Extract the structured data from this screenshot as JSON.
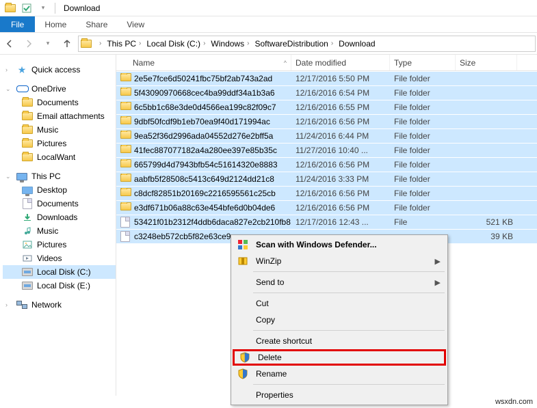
{
  "window": {
    "title": "Download"
  },
  "ribbon": {
    "file": "File",
    "tabs": [
      "Home",
      "Share",
      "View"
    ]
  },
  "breadcrumb": [
    "This PC",
    "Local Disk (C:)",
    "Windows",
    "SoftwareDistribution",
    "Download"
  ],
  "sidebar": {
    "quick": {
      "label": "Quick access"
    },
    "onedrive": {
      "label": "OneDrive",
      "children": [
        "Documents",
        "Email attachments",
        "Music",
        "Pictures",
        "LocalWant"
      ]
    },
    "thispc": {
      "label": "This PC",
      "children": [
        "Desktop",
        "Documents",
        "Downloads",
        "Music",
        "Pictures",
        "Videos",
        "Local Disk (C:)",
        "Local Disk (E:)"
      ]
    },
    "network": {
      "label": "Network"
    }
  },
  "columns": {
    "name": "Name",
    "date": "Date modified",
    "type": "Type",
    "size": "Size"
  },
  "rows": [
    {
      "icon": "folder",
      "name": "2e5e7fce6d50241fbc75bf2ab743a2ad",
      "date": "12/17/2016 5:50 PM",
      "type": "File folder",
      "size": ""
    },
    {
      "icon": "folder",
      "name": "5f43090970668cec4ba99ddf34a1b3a6",
      "date": "12/16/2016 6:54 PM",
      "type": "File folder",
      "size": ""
    },
    {
      "icon": "folder",
      "name": "6c5bb1c68e3de0d4566ea199c82f09c7",
      "date": "12/16/2016 6:55 PM",
      "type": "File folder",
      "size": ""
    },
    {
      "icon": "folder",
      "name": "9dbf50fcdf9b1eb70ea9f40d171994ac",
      "date": "12/16/2016 6:56 PM",
      "type": "File folder",
      "size": ""
    },
    {
      "icon": "folder",
      "name": "9ea52f36d2996ada04552d276e2bff5a",
      "date": "11/24/2016 6:44 PM",
      "type": "File folder",
      "size": ""
    },
    {
      "icon": "folder",
      "name": "41fec887077182a4a280ee397e85b35c",
      "date": "11/27/2016 10:40 ...",
      "type": "File folder",
      "size": ""
    },
    {
      "icon": "folder",
      "name": "665799d4d7943bfb54c51614320e8883",
      "date": "12/16/2016 6:56 PM",
      "type": "File folder",
      "size": ""
    },
    {
      "icon": "folder",
      "name": "aabfb5f28508c5413c649d2124dd21c8",
      "date": "11/24/2016 3:33 PM",
      "type": "File folder",
      "size": ""
    },
    {
      "icon": "folder",
      "name": "c8dcf82851b20169c2216595561c25cb",
      "date": "12/16/2016 6:56 PM",
      "type": "File folder",
      "size": ""
    },
    {
      "icon": "folder",
      "name": "e3df671b06a88c63e454bfe6d0b04de6",
      "date": "12/16/2016 6:56 PM",
      "type": "File folder",
      "size": ""
    },
    {
      "icon": "file",
      "name": "53421f01b2312f4ddb6daca827e2cb210fb8...",
      "date": "12/17/2016 12:43 ...",
      "type": "File",
      "size": "521 KB"
    },
    {
      "icon": "file",
      "name": "c3248eb572cb5f82e63ce9",
      "date": "",
      "type": "",
      "size": "39 KB"
    }
  ],
  "context_menu": {
    "scan": "Scan with Windows Defender...",
    "winzip": "WinZip",
    "sendto": "Send to",
    "cut": "Cut",
    "copy": "Copy",
    "shortcut": "Create shortcut",
    "delete": "Delete",
    "rename": "Rename",
    "properties": "Properties"
  },
  "watermark": "wsxdn.com"
}
